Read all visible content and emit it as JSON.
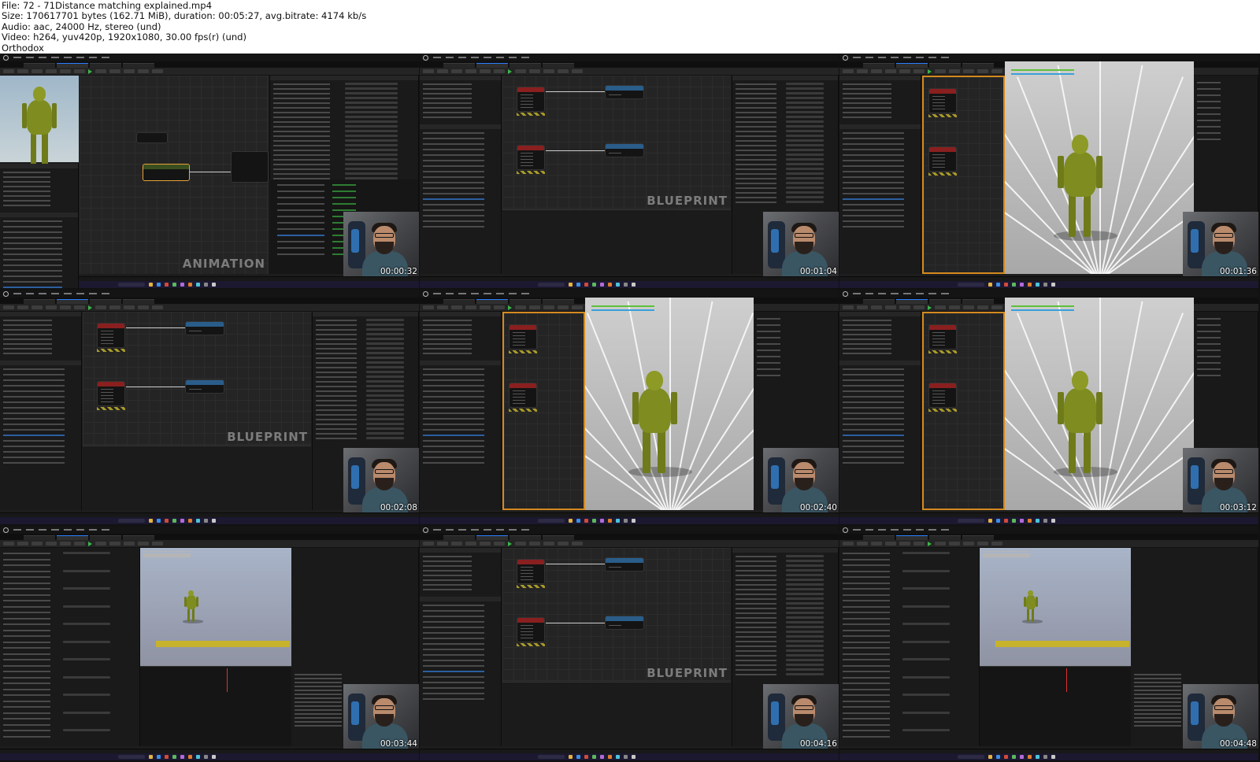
{
  "header": {
    "file": "File: 72 - 71Distance matching explained.mp4",
    "size": "Size: 170617701 bytes (162.71 MiB), duration: 00:05:27, avg.bitrate: 4174 kb/s",
    "audio": "Audio: aac, 24000 Hz, stereo (und)",
    "video": "Video: h264, yuv420p, 1920x1080, 30.00 fps(r) (und)",
    "author": "Orthodox"
  },
  "tiles": [
    {
      "timestamp": "00:00:32",
      "kind": "animation-graph",
      "watermark": "ANIMATION"
    },
    {
      "timestamp": "00:01:04",
      "kind": "blueprint",
      "watermark": "BLUEPRINT"
    },
    {
      "timestamp": "00:01:36",
      "kind": "viewport"
    },
    {
      "timestamp": "00:02:08",
      "kind": "blueprint",
      "watermark": "BLUEPRINT"
    },
    {
      "timestamp": "00:02:40",
      "kind": "viewport"
    },
    {
      "timestamp": "00:03:12",
      "kind": "viewport"
    },
    {
      "timestamp": "00:03:44",
      "kind": "anim-sequence"
    },
    {
      "timestamp": "00:04:16",
      "kind": "blueprint",
      "watermark": "BLUEPRINT"
    },
    {
      "timestamp": "00:04:48",
      "kind": "anim-sequence"
    }
  ],
  "colors": {
    "editor_bg": "#1d1d1d",
    "graph_bg": "#242424",
    "accent_blue": "#2a7fff",
    "selection_orange": "#e8a43a",
    "character_green": "#8d9a26",
    "taskbar": "#1b1830"
  }
}
